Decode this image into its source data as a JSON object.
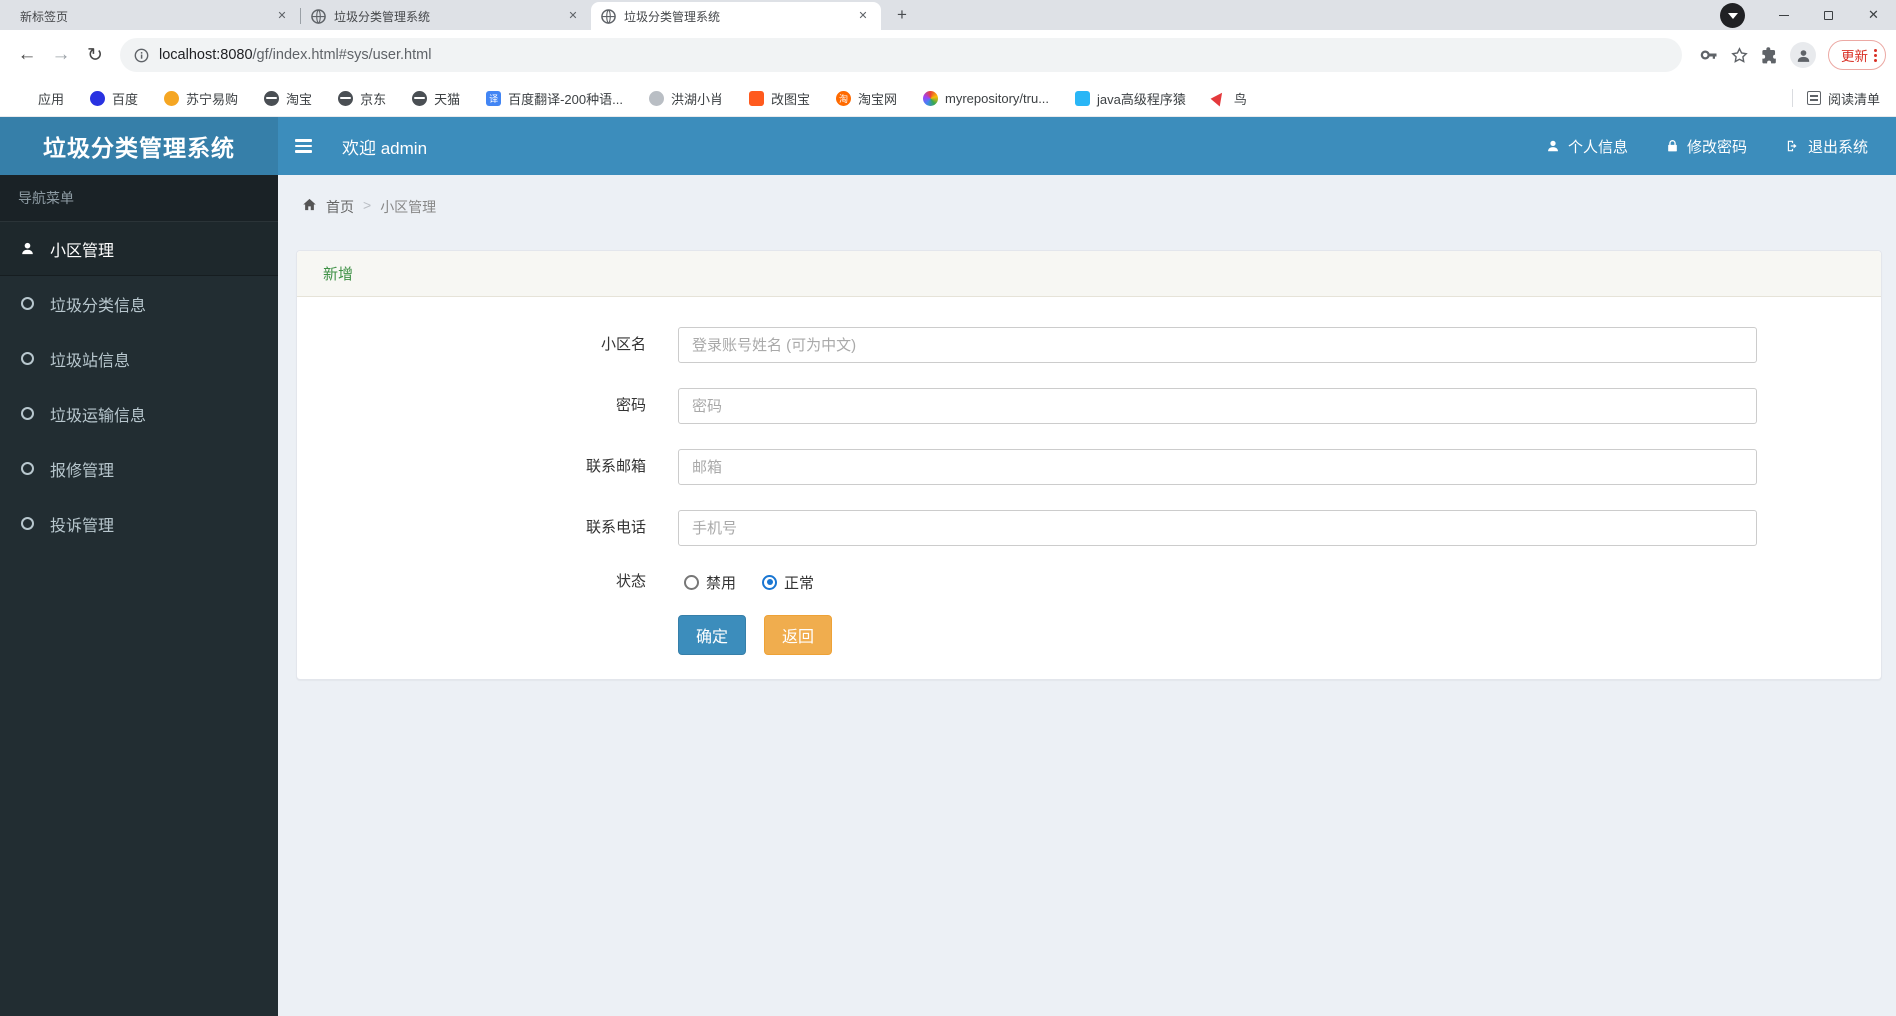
{
  "browser": {
    "tabs": [
      {
        "title": "新标签页",
        "active": false,
        "has_favicon": false
      },
      {
        "title": "垃圾分类管理系统",
        "active": false,
        "has_favicon": true
      },
      {
        "title": "垃圾分类管理系统",
        "active": true,
        "has_favicon": true
      }
    ],
    "url_host": "localhost:8080",
    "url_path": "/gf/index.html#sys/user.html",
    "update_button": "更新",
    "bookmarks": [
      {
        "label": "应用"
      },
      {
        "label": "百度"
      },
      {
        "label": "苏宁易购"
      },
      {
        "label": "淘宝"
      },
      {
        "label": "京东"
      },
      {
        "label": "天猫"
      },
      {
        "label": "百度翻译-200种语..."
      },
      {
        "label": "洪湖小肖"
      },
      {
        "label": "改图宝"
      },
      {
        "label": "淘宝网"
      },
      {
        "label": "myrepository/tru..."
      },
      {
        "label": "java高级程序猿"
      },
      {
        "label": "鸟"
      }
    ],
    "reading_list": "阅读清单",
    "fanyi_glyph": "译",
    "taobao_glyph": "淘"
  },
  "app": {
    "logo": "垃圾分类管理系统",
    "welcome": "欢迎 admin",
    "header_links": [
      {
        "label": "个人信息"
      },
      {
        "label": "修改密码"
      },
      {
        "label": "退出系统"
      }
    ],
    "sidebar": {
      "header": "导航菜单",
      "items": [
        {
          "label": "小区管理",
          "active": true
        },
        {
          "label": "垃圾分类信息",
          "active": false
        },
        {
          "label": "垃圾站信息",
          "active": false
        },
        {
          "label": "垃圾运输信息",
          "active": false
        },
        {
          "label": "报修管理",
          "active": false
        },
        {
          "label": "投诉管理",
          "active": false
        }
      ]
    },
    "breadcrumb": {
      "home": "首页",
      "current": "小区管理"
    },
    "panel": {
      "title": "新增",
      "fields": [
        {
          "label": "小区名",
          "placeholder": "登录账号姓名 (可为中文)",
          "value": ""
        },
        {
          "label": "密码",
          "placeholder": "密码",
          "value": ""
        },
        {
          "label": "联系邮箱",
          "placeholder": "邮箱",
          "value": ""
        },
        {
          "label": "联系电话",
          "placeholder": "手机号",
          "value": ""
        }
      ],
      "status": {
        "label": "状态",
        "options": [
          {
            "label": "禁用",
            "checked": false
          },
          {
            "label": "正常",
            "checked": true
          }
        ]
      },
      "buttons": [
        {
          "label": "确定",
          "type": "primary"
        },
        {
          "label": "返回",
          "type": "warning"
        }
      ]
    }
  },
  "colors": {
    "navbar": "#3c8dbc",
    "logo_bg": "#367fa9",
    "sidebar_bg": "#222d32",
    "content_bg": "#ecf0f5",
    "panel_title_green": "#3f9146",
    "primary_btn": "#3c8dbc",
    "warning_btn": "#f0ad4e",
    "update_red": "#d93025"
  }
}
